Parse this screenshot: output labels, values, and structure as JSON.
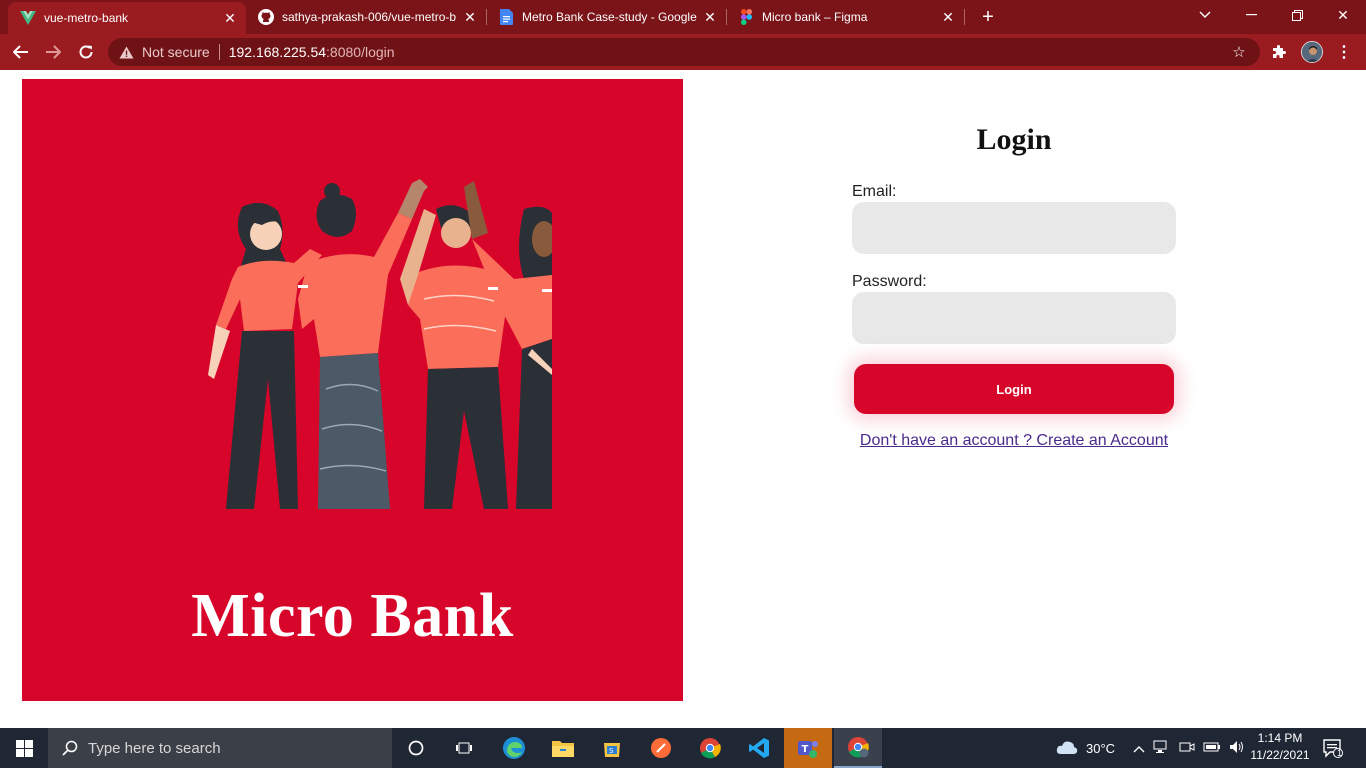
{
  "browser": {
    "tabs": [
      {
        "title": "vue-metro-bank",
        "icon": "vue-icon",
        "active": true
      },
      {
        "title": "sathya-prakash-006/vue-metro-b",
        "icon": "github-icon",
        "active": false
      },
      {
        "title": "Metro Bank Case-study - Google",
        "icon": "google-docs-icon",
        "active": false
      },
      {
        "title": "Micro bank – Figma",
        "icon": "figma-icon",
        "active": false
      }
    ],
    "address": {
      "security_label": "Not secure",
      "host": "192.168.225.54",
      "path": ":8080/login"
    },
    "colors": {
      "frame": "#7a1418",
      "toolbar": "#9a1b20",
      "omnibox": "#6e1216"
    }
  },
  "hero": {
    "brand": "Micro Bank",
    "background": "#d8052b"
  },
  "login": {
    "title": "Login",
    "email_label": "Email:",
    "email_value": "",
    "password_label": "Password:",
    "password_value": "",
    "submit_label": "Login",
    "signup_link": "Don't have an account ? Create an Account",
    "accent": "#d8052b"
  },
  "taskbar": {
    "search_placeholder": "Type here to search",
    "weather": "30°C",
    "time": "1:14 PM",
    "date": "11/22/2021",
    "notification_count": "1"
  }
}
